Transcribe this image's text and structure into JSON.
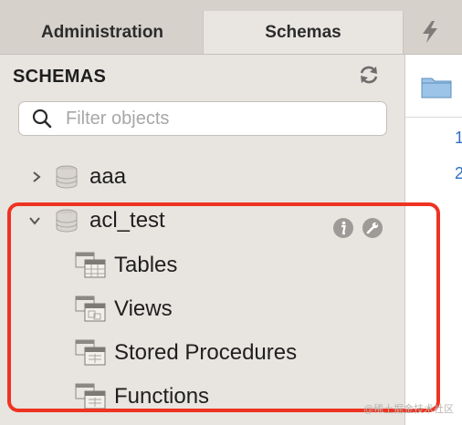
{
  "tabs": {
    "administration": "Administration",
    "schemas": "Schemas"
  },
  "sidebar": {
    "title": "SCHEMAS",
    "search_placeholder": "Filter objects",
    "schemas": [
      {
        "name": "aaa",
        "expanded": false
      },
      {
        "name": "acl_test",
        "expanded": true,
        "children": [
          "Tables",
          "Views",
          "Stored Procedures",
          "Functions"
        ]
      }
    ]
  },
  "editor": {
    "line_numbers": [
      "1",
      "2"
    ]
  },
  "watermark": "@稀土掘金技术社区",
  "colors": {
    "highlight": "#ee3322",
    "sidebar_bg": "#e8e4e0",
    "tabbar_bg": "#d6d1cb",
    "line_number": "#2f6fc0"
  },
  "icons": {
    "refresh": "refresh-icon",
    "search": "search-icon",
    "database": "database-icon",
    "info": "info-icon",
    "wrench": "wrench-icon",
    "bolt": "bolt-icon",
    "folder": "folder-icon"
  }
}
